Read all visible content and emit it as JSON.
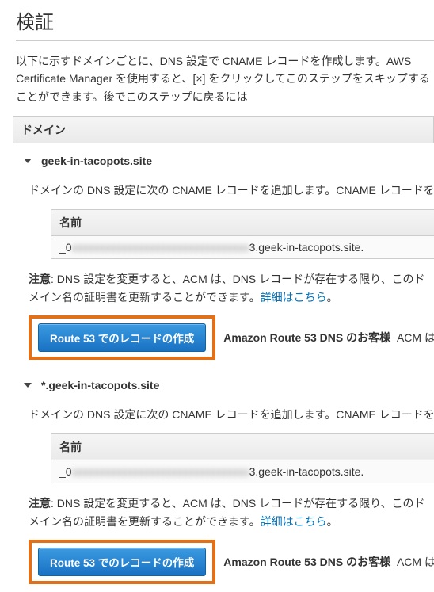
{
  "title": "検証",
  "intro": "以下に示すドメインごとに、DNS 設定で CNAME レコードを作成します。AWS Certificate Manager を使用すると、[×] をクリックしてこのステップをスキップすることができます。後でこのステップに戻るには",
  "section_header": "ドメイン",
  "domains": [
    {
      "name": "geek-in-tacopots.site",
      "desc": "ドメインの DNS 設定に次の CNAME レコードを追加します。CNAME レコードを",
      "record_header": "名前",
      "record_prefix": "_0",
      "record_blur": "xxxxxxxxxxxxxxxxxxxxxxxxxxxxxxxx",
      "record_suffix": "3.geek-in-tacopots.site.",
      "note_label": "注意",
      "note_text": ": DNS 設定を変更すると、ACM は、DNS レコードが存在する限り、このドメイン名の証明書を更新することができます。",
      "learn_more": "詳細はこちら",
      "period": "。",
      "button": "Route 53 でのレコードの作成",
      "route53_label": "Amazon Route 53 DNS のお客様",
      "route53_tail": " ACM は"
    },
    {
      "name": "*.geek-in-tacopots.site",
      "desc": "ドメインの DNS 設定に次の CNAME レコードを追加します。CNAME レコードを",
      "record_header": "名前",
      "record_prefix": "_0",
      "record_blur": "xxxxxxxxxxxxxxxxxxxxxxxxxxxxxxxx",
      "record_suffix": "3.geek-in-tacopots.site.",
      "note_label": "注意",
      "note_text": ": DNS 設定を変更すると、ACM は、DNS レコードが存在する限り、このドメイン名の証明書を更新することができます。",
      "learn_more": "詳細はこちら",
      "period": "。",
      "button": "Route 53 でのレコードの作成",
      "route53_label": "Amazon Route 53 DNS のお客様",
      "route53_tail": " ACM は"
    }
  ]
}
